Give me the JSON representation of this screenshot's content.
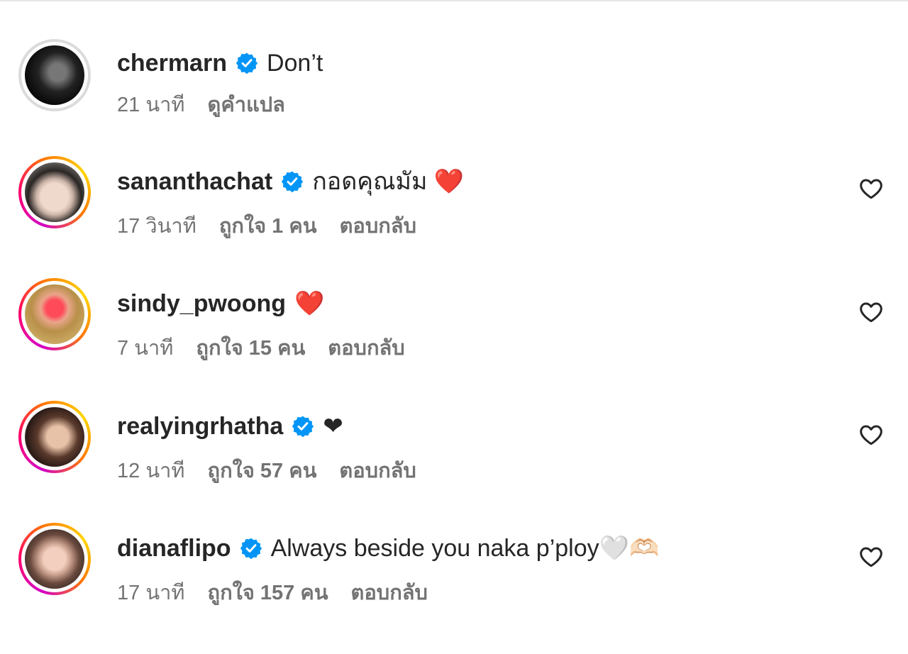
{
  "comments": [
    {
      "username": "chermarn",
      "verified": true,
      "text": "Don’t",
      "time": "21 นาที",
      "likes": "",
      "action": "ดูคำแปล",
      "avatar_icon": "avatar-photo",
      "ring": "plain"
    },
    {
      "username": "sananthachat",
      "verified": true,
      "text": "กอดคุณมัม ❤️",
      "time": "17 วินาที",
      "likes": "ถูกใจ 1 คน",
      "action": "ตอบกลับ",
      "avatar_icon": "avatar-photo",
      "ring": "story"
    },
    {
      "username": "sindy_pwoong",
      "verified": false,
      "text": "❤️",
      "time": "7 นาที",
      "likes": "ถูกใจ 15 คน",
      "action": "ตอบกลับ",
      "avatar_icon": "avatar-photo",
      "ring": "story"
    },
    {
      "username": "realyingrhatha",
      "verified": true,
      "text": "❤",
      "time": "12 นาที",
      "likes": "ถูกใจ 57 คน",
      "action": "ตอบกลับ",
      "avatar_icon": "avatar-photo",
      "ring": "story"
    },
    {
      "username": "dianaflipo",
      "verified": true,
      "text": "Always beside you naka p’ploy🤍🫶🏻",
      "time": "17 นาที",
      "likes": "ถูกใจ 157 คน",
      "action": "ตอบกลับ",
      "avatar_icon": "avatar-photo",
      "ring": "story"
    }
  ],
  "colors": {
    "verified_blue": "#0095f6",
    "text_primary": "#262626",
    "text_secondary": "#737373",
    "heart_red": "#e0245e"
  },
  "icons": {
    "verified": "verified-badge-icon",
    "like": "heart-outline-icon"
  }
}
